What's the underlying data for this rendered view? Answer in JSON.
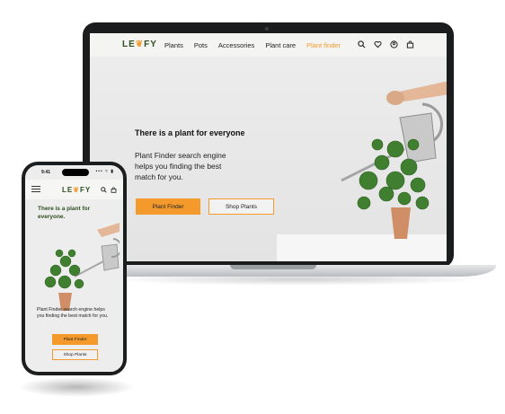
{
  "brand": {
    "logo_left": "LE",
    "logo_right": "FY"
  },
  "laptop": {
    "nav": {
      "links": [
        "Plants",
        "Pots",
        "Accessories",
        "Plant care",
        "Plant finder"
      ],
      "active_index": 4,
      "icons": [
        "search-icon",
        "heart-icon",
        "user-icon",
        "bag-icon"
      ]
    },
    "hero": {
      "title": "There is a plant for everyone",
      "text": "Plant Finder search engine helps you finding the best match for you.",
      "primary_button": "Plant Finder",
      "secondary_button": "Shop Plants"
    }
  },
  "phone": {
    "status": {
      "time": "9:41",
      "signal": "••• ≈ ▮"
    },
    "nav": {
      "icons": [
        "menu-icon",
        "search-icon",
        "bag-icon"
      ]
    },
    "hero": {
      "title": "There is a plant for everyone.",
      "text": "Plant Finder search engine helps you finding the best match for you.",
      "primary_button": "Plant Finder",
      "secondary_button": "Shop Plants"
    }
  },
  "colors": {
    "accent": "#f49a2c",
    "brand_green": "#2e4f1e",
    "background": "#ececec"
  }
}
